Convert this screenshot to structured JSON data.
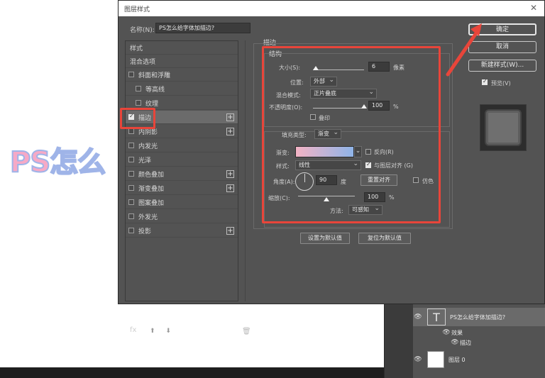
{
  "dialog": {
    "title": "图层样式",
    "close": "✕"
  },
  "name": {
    "label": "名称(N):",
    "value": "PS怎么给字体加描边?"
  },
  "styles": {
    "header": "样式",
    "blend": "混合选项",
    "items": [
      {
        "label": "斜面和浮雕",
        "checked": false,
        "plus": false,
        "indent": false
      },
      {
        "label": "等高线",
        "checked": false,
        "plus": false,
        "indent": true
      },
      {
        "label": "纹理",
        "checked": false,
        "plus": false,
        "indent": true
      },
      {
        "label": "描边",
        "checked": true,
        "plus": true,
        "indent": false
      },
      {
        "label": "内阴影",
        "checked": false,
        "plus": true,
        "indent": false
      },
      {
        "label": "内发光",
        "checked": false,
        "plus": false,
        "indent": false
      },
      {
        "label": "光泽",
        "checked": false,
        "plus": false,
        "indent": false
      },
      {
        "label": "颜色叠加",
        "checked": false,
        "plus": true,
        "indent": false
      },
      {
        "label": "渐变叠加",
        "checked": false,
        "plus": true,
        "indent": false
      },
      {
        "label": "图案叠加",
        "checked": false,
        "plus": false,
        "indent": false
      },
      {
        "label": "外发光",
        "checked": false,
        "plus": false,
        "indent": false
      },
      {
        "label": "投影",
        "checked": false,
        "plus": true,
        "indent": false
      }
    ],
    "fx": "fx",
    "up_down": "⬆ ⬇",
    "trash": "🗑"
  },
  "stroke": {
    "section": "描边",
    "structure": "结构",
    "size_label": "大小(S):",
    "size_value": "6",
    "size_unit": "像素",
    "position_label": "位置:",
    "position_value": "外部",
    "blend_label": "混合模式:",
    "blend_value": "正片叠底",
    "opacity_label": "不透明度(O):",
    "opacity_value": "100",
    "opacity_unit": "%",
    "overprint": "叠印",
    "fill_type_label": "填充类型:",
    "fill_type_value": "渐变",
    "gradient_label": "渐变:",
    "reverse": "反向(R)",
    "style_label": "样式:",
    "style_value": "线性",
    "align": "与图层对齐 (G)",
    "angle_label": "角度(A):",
    "angle_value": "90",
    "angle_unit": "度",
    "reset_align": "重置对齐",
    "dither": "仿色",
    "scale_label": "缩放(C):",
    "scale_value": "100",
    "scale_unit": "%",
    "method_label": "方法:",
    "method_value": "可感知",
    "set_default": "设置为默认值",
    "reset_default": "复位为默认值",
    "size_level": 0.05,
    "opacity_level": 1.0,
    "scale_level": 0.5
  },
  "right": {
    "ok": "确定",
    "cancel": "取消",
    "new_style": "新建样式(W)...",
    "preview": "预览(V)"
  },
  "canvas": {
    "text": "PS怎么"
  },
  "layers": {
    "text_layer": "PS怎么给字体加描边?",
    "effects": "效果",
    "stroke": "描边",
    "bg_layer": "图层 0",
    "text_thumb": "T"
  },
  "colors": {
    "highlight": "#e8453a",
    "panel": "#535353"
  }
}
